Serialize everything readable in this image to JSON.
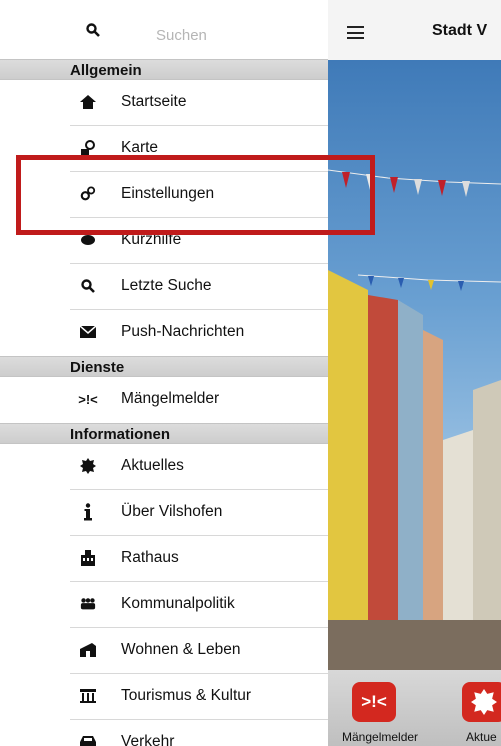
{
  "search": {
    "placeholder": "Suchen",
    "icon": "search-icon"
  },
  "sections": {
    "allgemein": "Allgemein",
    "dienste": "Dienste",
    "informationen": "Informationen"
  },
  "menu": {
    "startseite": "Startseite",
    "karte": "Karte",
    "einstellungen": "Einstellungen",
    "kurzhilfe": "Kurzhilfe",
    "letzte_suche": "Letzte Suche",
    "push": "Push-Nachrichten",
    "maengelmelder": "Mängelmelder",
    "maengel_glyph": ">!<",
    "aktuelles": "Aktuelles",
    "ueber": "Über Vilshofen",
    "rathaus": "Rathaus",
    "kommunalpolitik": "Kommunalpolitik",
    "wohnen": "Wohnen & Leben",
    "tourismus": "Tourismus & Kultur",
    "verkehr": "Verkehr"
  },
  "topbar": {
    "title": "Stadt V"
  },
  "bottom": {
    "tile1_glyph": ">!<",
    "tile1_label": "Mängelmelder",
    "tile2_label": "Aktue"
  },
  "colors": {
    "accent": "#d3281f",
    "highlight": "#c01b1b"
  }
}
